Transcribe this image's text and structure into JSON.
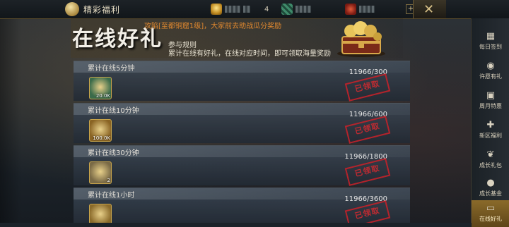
{
  "topbar": {
    "title": "精彩福利",
    "resources": [
      {
        "icon": "gold-ingot-icon",
        "value": ""
      },
      {
        "icon": "green-gem-icon",
        "value": ""
      },
      {
        "icon": "red-gift-icon",
        "value": ""
      }
    ],
    "level_number": "4"
  },
  "banner": {
    "title": "在线好礼",
    "notice": "攻陷[至都铜窟1级]，大家前去助战瓜分奖励",
    "rules_title": "参与规则",
    "rules_text": "累计在线有好礼，在线对应时间，即可领取海量奖励"
  },
  "rewards": [
    {
      "label": "累计在线5分钟",
      "progress": "11966/300",
      "item_icon": "jade-coin-icon",
      "qty": "20.0K",
      "status": "已领取",
      "color": "#3a6b4a"
    },
    {
      "label": "累计在线10分钟",
      "progress": "11966/600",
      "item_icon": "grain-bundle-icon",
      "qty": "100.0K",
      "status": "已领取",
      "color": "#8a6424"
    },
    {
      "label": "累计在线30分钟",
      "progress": "11966/1800",
      "item_icon": "arrow-bundle-icon",
      "qty": "2",
      "status": "已领取",
      "color": "#7a6a46"
    },
    {
      "label": "累计在线1小时",
      "progress": "11966/3600",
      "item_icon": "gold-item-icon",
      "qty": "",
      "status": "已领取",
      "color": "#8a6a2a"
    }
  ],
  "nav": [
    {
      "label": "每日签到",
      "icon": "calendar-icon",
      "glyph": "▦"
    },
    {
      "label": "许愿有礼",
      "icon": "wish-lamp-icon",
      "glyph": "◉"
    },
    {
      "label": "周月特惠",
      "icon": "card-icon",
      "glyph": "▣"
    },
    {
      "label": "新区福利",
      "icon": "present-icon",
      "glyph": "✚"
    },
    {
      "label": "成长礼包",
      "icon": "leaf-icon",
      "glyph": "❦"
    },
    {
      "label": "成长基金",
      "icon": "money-bag-icon",
      "glyph": "●"
    },
    {
      "label": "在线好礼",
      "icon": "monitor-icon",
      "glyph": "▭",
      "active": true
    }
  ],
  "colors": {
    "accent": "#c8a44a",
    "stamp": "#c4222a",
    "notice": "#e0882f"
  }
}
